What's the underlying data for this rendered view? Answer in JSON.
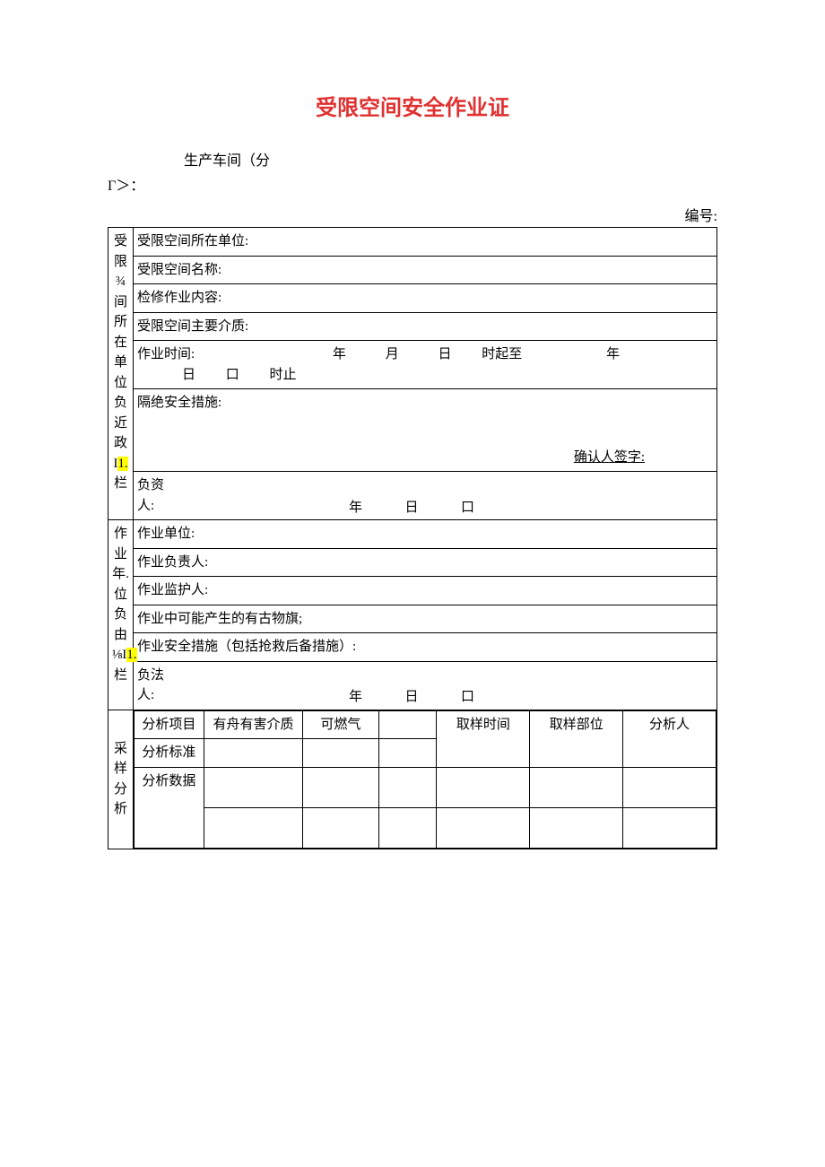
{
  "title": "受限空间安全作业证",
  "subhead_line1": "生产车间（分",
  "subhead_line2": "Γ＞：",
  "serial_label": "编号:",
  "sideA": {
    "prefix": "受限¾间所在单位负近政I",
    "hl": "1.",
    "suffix": "栏"
  },
  "secA": {
    "r1": "受限空间所在单位:",
    "r2": "受限空间名称:",
    "r3": "检修作业内容:",
    "r4": "受限空间主要介质:",
    "time": {
      "label": "作业时间:",
      "y": "年",
      "m": "月",
      "d": "日",
      "from": "时起至",
      "y2": "年",
      "line2_m": "日",
      "line2_d": "口",
      "line2_end": "时止"
    },
    "r6_label": "隔绝安全措施:",
    "r6_sign": "确认人签字:",
    "r7_a": "负资",
    "r7_b": "人:",
    "r7_date": {
      "y": "年",
      "m": "日",
      "d": "口"
    }
  },
  "sideB": {
    "prefix": "作业年.位负由⅛I",
    "hl": "1.",
    "suffix": "栏"
  },
  "secB": {
    "r1": "作业单位:",
    "r2": "作业负责人:",
    "r3": "作业监护人:",
    "r4": "作业中可能产生的有古物旗;",
    "r5": "作业安全措施（包括抢救后备措施）:",
    "r6_a": "负法",
    "r6_b": "人:",
    "r6_date": {
      "y": "年",
      "m": "日",
      "d": "口"
    }
  },
  "sideC": "采样分析",
  "analysis": {
    "h1": "分析项目",
    "h2": "有舟有害介质",
    "h3": "可燃气",
    "h4": "",
    "h5": "取样时间",
    "h6": "取样部位",
    "h7": "分析人",
    "r2c1": "分析标准",
    "r3c1": "分析数据"
  }
}
